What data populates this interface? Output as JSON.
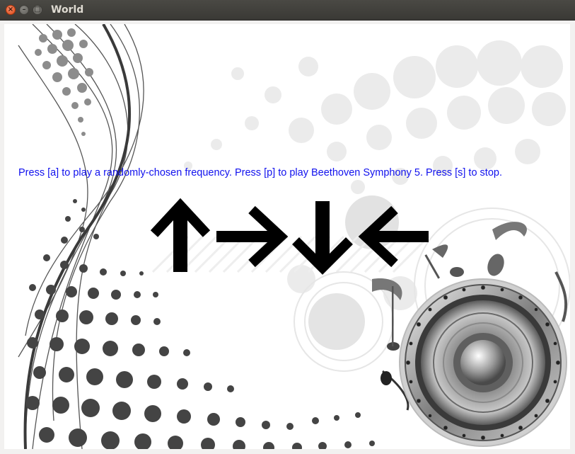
{
  "window": {
    "title": "World",
    "controls": {
      "close_glyph": "×",
      "minimize_glyph": "–",
      "maximize_glyph": "□"
    }
  },
  "canvas": {
    "instructions": "Press [a] to play a randomly-chosen frequency. Press [p] to play Beethoven Symphony 5. Press [s] to stop.",
    "arrows": [
      "up",
      "right",
      "down",
      "left"
    ],
    "text_color": "#1111ee",
    "background_art": [
      "halftone-wave",
      "speaker",
      "music-notes"
    ]
  },
  "colors": {
    "titlebar": "#3c3b37",
    "close_button": "#df4a16",
    "arrow": "#000000"
  }
}
